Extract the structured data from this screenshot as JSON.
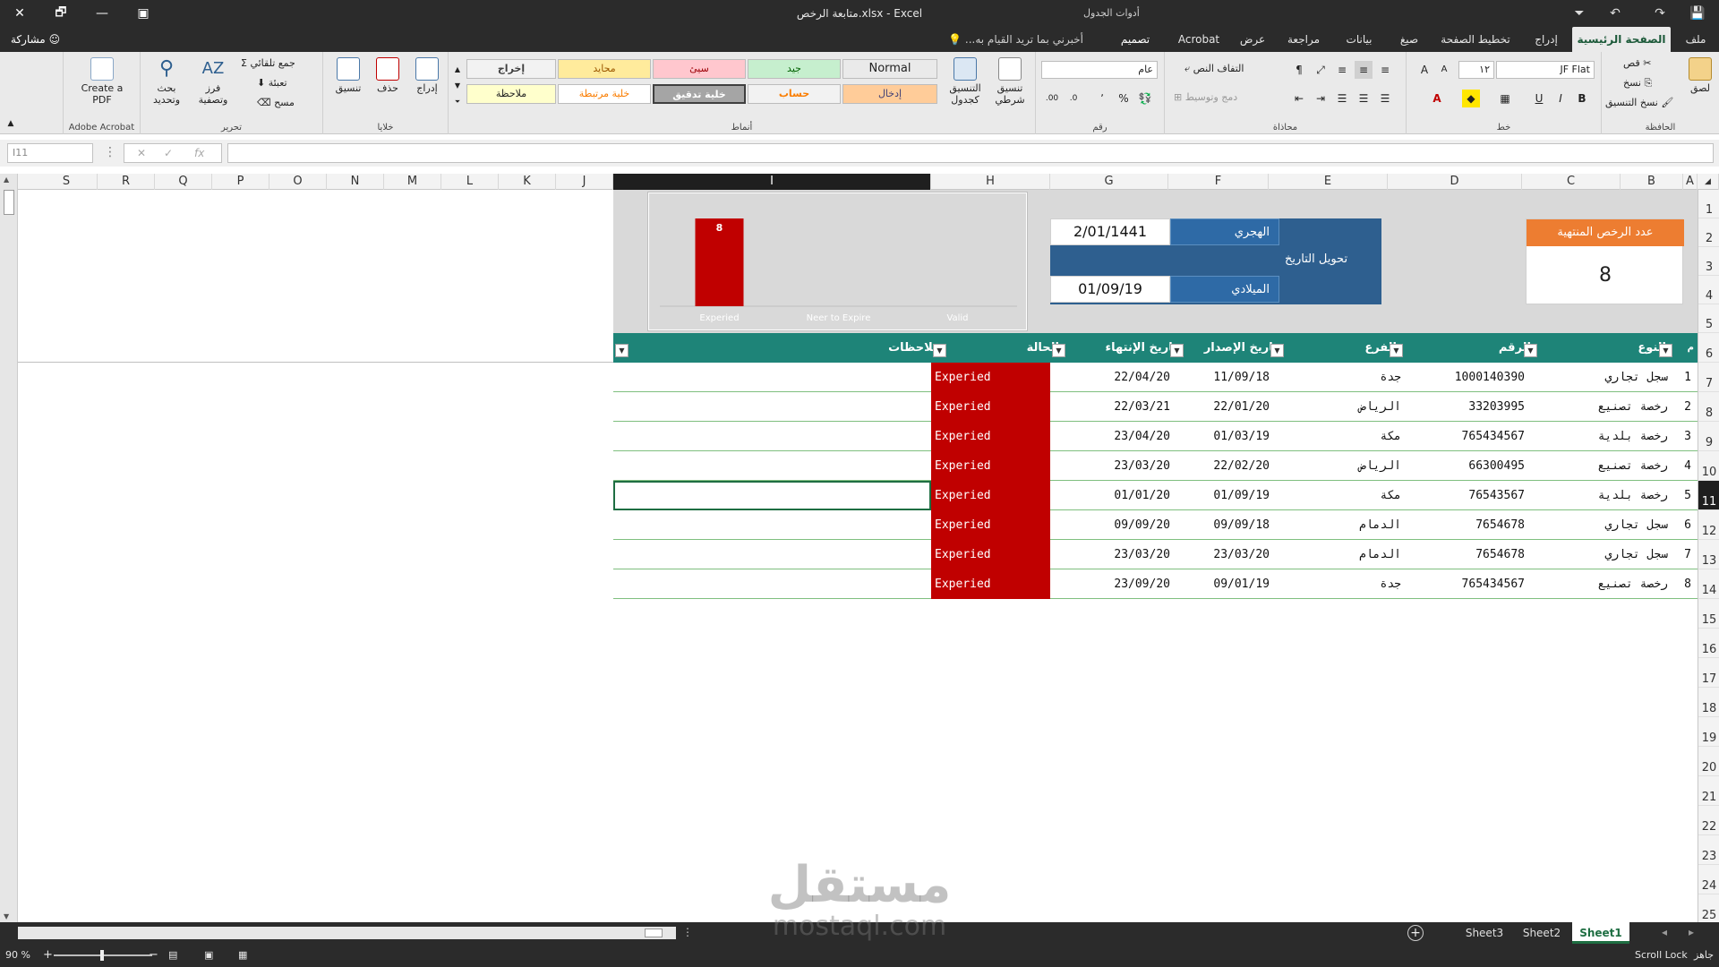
{
  "window": {
    "title": "متابعة الرخص.xlsx - Excel",
    "context_group": "أدوات الجدول",
    "close": "✕",
    "restore": "🗗",
    "minimize": "—",
    "ribbon_opts": "▣"
  },
  "qat": {
    "save": "💾",
    "undo": "↶",
    "redo": "↷",
    "customize": "⏷"
  },
  "tabs": [
    {
      "label": "ملف"
    },
    {
      "label": "الصفحة الرئيسية"
    },
    {
      "label": "إدراج"
    },
    {
      "label": "تخطيط الصفحة"
    },
    {
      "label": "صيغ"
    },
    {
      "label": "بيانات"
    },
    {
      "label": "مراجعة"
    },
    {
      "label": "عرض"
    },
    {
      "label": "Acrobat"
    },
    {
      "label": "تصميم"
    }
  ],
  "tell_me": "أخبرني بما تريد القيام به...",
  "share": "مشاركة",
  "ribbon": {
    "clipboard": {
      "label": "الحافظة",
      "paste": "لصق",
      "cut": "قص",
      "copy": "نسخ",
      "format_painter": "نسخ التنسيق"
    },
    "font": {
      "label": "خط",
      "name": "JF Flat",
      "size": "١٢",
      "bold": "B",
      "italic": "I",
      "underline": "U"
    },
    "alignment": {
      "label": "محاذاة",
      "wrap": "التفاف النص",
      "merge": "دمج وتوسيط"
    },
    "number": {
      "label": "رقم",
      "format": "عام",
      "percent": "%",
      "comma": "٬"
    },
    "styles": {
      "label": "أنماط",
      "conditional": "تنسيق شرطي",
      "as_table": "التنسيق كجدول",
      "cells": [
        {
          "name": "Normal",
          "bg": "#ffffff",
          "fg": "#000000"
        },
        {
          "name": "جيد",
          "bg": "#c6efce",
          "fg": "#006100"
        },
        {
          "name": "سيئ",
          "bg": "#ffc7ce",
          "fg": "#9c0006"
        },
        {
          "name": "محايد",
          "bg": "#ffeb9c",
          "fg": "#9c5700"
        },
        {
          "name": "إخراج",
          "bg": "#f2f2f2",
          "fg": "#3f3f3f"
        },
        {
          "name": "إدخال",
          "bg": "#ffcc99",
          "fg": "#3f3f76"
        },
        {
          "name": "حساب",
          "bg": "#f2f2f2",
          "fg": "#fa7d00"
        },
        {
          "name": "خلية تدقيق",
          "bg": "#a5a5a5",
          "fg": "#ffffff"
        },
        {
          "name": "خلية مرتبطة",
          "bg": "#ffffff",
          "fg": "#fa7d00"
        },
        {
          "name": "ملاحظة",
          "bg": "#ffffcc",
          "fg": "#000000"
        }
      ]
    },
    "cells": {
      "label": "خلايا",
      "insert": "إدراج",
      "delete": "حذف",
      "format": "تنسيق"
    },
    "editing": {
      "label": "تحرير",
      "autosum": "جمع تلقائي",
      "fill": "تعبئة",
      "clear": "مسح",
      "sort": "فرز وتصفية",
      "find": "بحث وتحديد"
    },
    "acrobat": {
      "label": "Adobe Acrobat",
      "create": "Create a PDF"
    }
  },
  "formula_bar": {
    "name_box": "I11",
    "fx": "fx",
    "cancel": "✕",
    "enter": "✓"
  },
  "columns": [
    "A",
    "B",
    "C",
    "D",
    "E",
    "F",
    "G",
    "H",
    "I",
    "J",
    "K",
    "L",
    "M",
    "N",
    "O",
    "P",
    "Q",
    "R",
    "S"
  ],
  "rows": [
    "1",
    "2",
    "3",
    "4",
    "5",
    "6",
    "7",
    "8",
    "9",
    "10",
    "11",
    "12",
    "13",
    "14",
    "15",
    "16",
    "17",
    "18",
    "19",
    "20",
    "21",
    "22",
    "23",
    "24",
    "25"
  ],
  "selected": {
    "column": "I",
    "row": "11"
  },
  "date_converter": {
    "title": "تحويل التاريخ",
    "hijri_label": "الهجري",
    "hijri_value": "2/01/1441",
    "gregorian_label": "الميلادي",
    "gregorian_value": "01/09/19"
  },
  "expired_count": {
    "title": "عدد الرخص المنتهية",
    "value": "8"
  },
  "chart_data": {
    "type": "bar",
    "categories": [
      "Experied",
      "Neer to Expire",
      "Valid"
    ],
    "values": [
      8,
      0,
      0
    ],
    "data_labels": [
      "8",
      "",
      ""
    ],
    "ylim": [
      0,
      8
    ],
    "color": "#c00000",
    "grid": false,
    "legend": "none"
  },
  "table": {
    "headers": {
      "idx": "م",
      "type": "النوع",
      "number": "الرقم",
      "branch": "الفرع",
      "issue": "تاريخ الإصدار",
      "expiry": "تاريخ الإنتهاء",
      "status": "الحالة",
      "notes": "ملاحظات"
    },
    "rows": [
      {
        "idx": "1",
        "type": "سجل تجاري",
        "number": "1000140390",
        "branch": "جدة",
        "issue": "11/09/18",
        "expiry": "22/04/20",
        "status": "Experied",
        "notes": ""
      },
      {
        "idx": "2",
        "type": "رخصة تصنيع",
        "number": "33203995",
        "branch": "الرياض",
        "issue": "22/01/20",
        "expiry": "22/03/21",
        "status": "Experied",
        "notes": ""
      },
      {
        "idx": "3",
        "type": "رخصة بلدية",
        "number": "765434567",
        "branch": "مكة",
        "issue": "01/03/19",
        "expiry": "23/04/20",
        "status": "Experied",
        "notes": ""
      },
      {
        "idx": "4",
        "type": "رخصة تصنيع",
        "number": "66300495",
        "branch": "الرياض",
        "issue": "22/02/20",
        "expiry": "23/03/20",
        "status": "Experied",
        "notes": ""
      },
      {
        "idx": "5",
        "type": "رخصة بلدية",
        "number": "76543567",
        "branch": "مكة",
        "issue": "01/09/19",
        "expiry": "01/01/20",
        "status": "Experied",
        "notes": ""
      },
      {
        "idx": "6",
        "type": "سجل تجاري",
        "number": "7654678",
        "branch": "الدمام",
        "issue": "09/09/18",
        "expiry": "09/09/20",
        "status": "Experied",
        "notes": ""
      },
      {
        "idx": "7",
        "type": "سجل تجاري",
        "number": "7654678",
        "branch": "الدمام",
        "issue": "23/03/20",
        "expiry": "23/03/20",
        "status": "Experied",
        "notes": ""
      },
      {
        "idx": "8",
        "type": "رخصة تصنيع",
        "number": "765434567",
        "branch": "جدة",
        "issue": "09/01/19",
        "expiry": "23/09/20",
        "status": "Experied",
        "notes": ""
      }
    ]
  },
  "sheets": [
    {
      "name": "Sheet1",
      "active": true
    },
    {
      "name": "Sheet2",
      "active": false
    },
    {
      "name": "Sheet3",
      "active": false
    }
  ],
  "status": {
    "ready": "جاهز",
    "scroll_lock": "Scroll Lock",
    "zoom": "90 %"
  },
  "watermark": {
    "ar": "مستقل",
    "en": "mostaql.com"
  }
}
